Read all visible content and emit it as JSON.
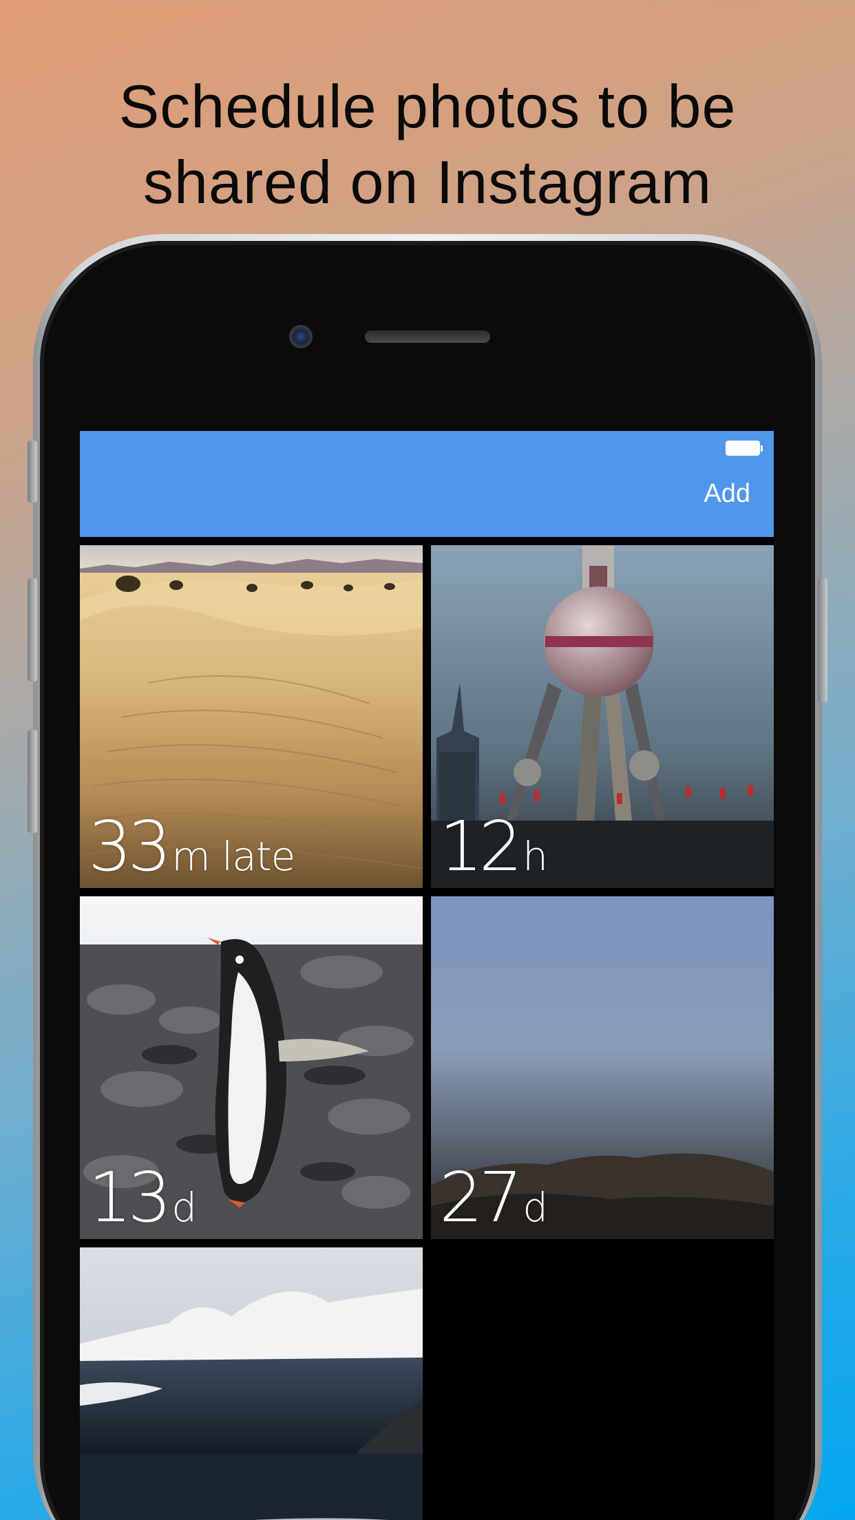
{
  "headline": {
    "line1": "Schedule photos to be",
    "line2": "shared on Instagram"
  },
  "navbar": {
    "add_label": "Add",
    "battery_icon": "battery-full-icon",
    "background": "#5097ec"
  },
  "photos": [
    {
      "subject": "desert-dunes",
      "value": "33",
      "unit": "m late"
    },
    {
      "subject": "tv-tower",
      "value": "12",
      "unit": "h"
    },
    {
      "subject": "penguin",
      "value": "13",
      "unit": "d"
    },
    {
      "subject": "hazy-dunes",
      "value": "27",
      "unit": "d"
    },
    {
      "subject": "snowy-mountains"
    }
  ]
}
